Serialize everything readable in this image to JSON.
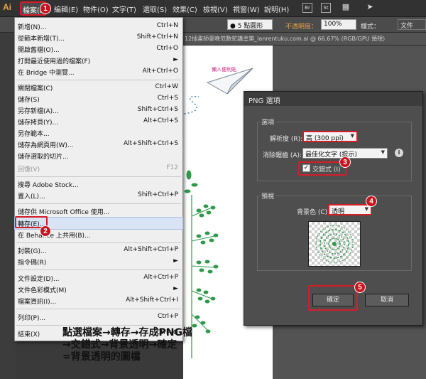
{
  "app": {
    "logo": "Ai"
  },
  "menubar": {
    "items": [
      "檔案(F)",
      "編輯(E)",
      "物件(O)",
      "文字(T)",
      "選取(S)",
      "效果(C)",
      "檢視(V)",
      "視窗(W)",
      "說明(H)"
    ],
    "icons": {
      "br": "Br",
      "st": "St"
    }
  },
  "controlbar": {
    "stroke_label": "● 5 點圓形",
    "opacity_label": "不透明度：",
    "opacity_value": "100%",
    "style_label": "樣式：",
    "doc_setup": "文件"
  },
  "document": {
    "tab_title": "12插畫師豪晚范數蛇講塗第_lanrentuku.com.ai @ 66.67% (RGB/GPU 預視)"
  },
  "file_menu": {
    "items": [
      {
        "label": "新增(N)...",
        "shortcut": "Ctrl+N"
      },
      {
        "label": "從範本新增(T)...",
        "shortcut": "Shift+Ctrl+N"
      },
      {
        "label": "開啟舊檔(O)...",
        "shortcut": "Ctrl+O"
      },
      {
        "label": "打開最近使用過的檔案(F)",
        "shortcut": "►"
      },
      {
        "label": "在 Bridge 中瀏覽...",
        "shortcut": "Alt+Ctrl+O"
      },
      {
        "label": "關閉檔案(C)",
        "shortcut": "Ctrl+W"
      },
      {
        "label": "儲存(S)",
        "shortcut": "Ctrl+S"
      },
      {
        "label": "另存新檔(A)...",
        "shortcut": "Shift+Ctrl+S"
      },
      {
        "label": "儲存拷貝(Y)...",
        "shortcut": "Alt+Ctrl+S"
      },
      {
        "label": "另存範本...",
        "shortcut": ""
      },
      {
        "label": "儲存為網頁用(W)...",
        "shortcut": "Alt+Shift+Ctrl+S"
      },
      {
        "label": "儲存選取的切片...",
        "shortcut": ""
      },
      {
        "label": "回復(V)",
        "shortcut": "F12"
      },
      {
        "label": "搜尋 Adobe Stock...",
        "shortcut": ""
      },
      {
        "label": "置入(L)...",
        "shortcut": "Shift+Ctrl+P"
      },
      {
        "label": "儲存供 Microsoft Office 使用...",
        "shortcut": ""
      },
      {
        "label": "轉存(E)...",
        "shortcut": ""
      },
      {
        "label": "在 Behance 上共用(B)...",
        "shortcut": ""
      },
      {
        "label": "封裝(G)...",
        "shortcut": "Alt+Shift+Ctrl+P"
      },
      {
        "label": "指令碼(R)",
        "shortcut": "►"
      },
      {
        "label": "文件設定(D)...",
        "shortcut": "Alt+Ctrl+P"
      },
      {
        "label": "文件色彩模式(M)",
        "shortcut": "►"
      },
      {
        "label": "檔案資訊(I)...",
        "shortcut": "Alt+Shift+Ctrl+I"
      },
      {
        "label": "列印(P)...",
        "shortcut": "Ctrl+P"
      },
      {
        "label": "結束(X)",
        "shortcut": "Ctrl+Q"
      }
    ]
  },
  "dialog": {
    "title": "PNG 選項",
    "options_group": "選項",
    "resolution_label": "解析度 (R):",
    "resolution_value": "高 (300 ppi)",
    "antialias_label": "消除鋸齒 (A):",
    "antialias_value": "最佳化文字 (提示)",
    "interlace_label": "交錯式 (I)",
    "preview_group": "預視",
    "bg_label": "背景色 (C):",
    "bg_value": "透明",
    "ok_label": "確定",
    "cancel_label": "取消"
  },
  "steps": [
    "1",
    "2",
    "3",
    "4",
    "5"
  ],
  "annotation": {
    "line1": "點選檔案→轉存→存成PNG檔",
    "line2": "→交錯式→背景透明→確定",
    "line3": "=背景透明的圖檔"
  },
  "colors": {
    "accent_red": "#d51d2a",
    "leaf_green": "#2e9a4a",
    "dotted_blue": "#2f7fc7"
  }
}
